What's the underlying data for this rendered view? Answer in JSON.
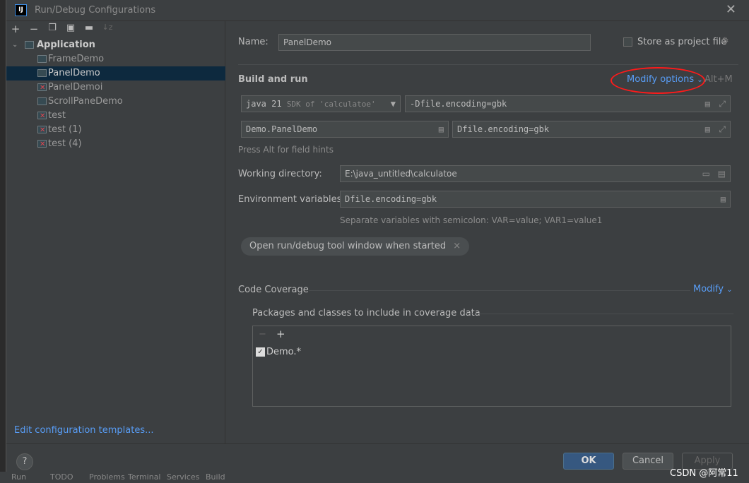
{
  "window": {
    "title": "Run/Debug Configurations",
    "logo": "IJ"
  },
  "toolbar": {
    "icons": [
      "plus-icon",
      "minus-icon",
      "copy-icon",
      "save-icon",
      "new-folder-icon",
      "sort-az-icon"
    ]
  },
  "tree": {
    "root": "Application",
    "items": [
      {
        "label": "FrameDemo",
        "error": false,
        "selected": false
      },
      {
        "label": "PanelDemo",
        "error": false,
        "selected": true
      },
      {
        "label": "PanelDemoi",
        "error": true,
        "selected": false
      },
      {
        "label": "ScrollPaneDemo",
        "error": false,
        "selected": false
      },
      {
        "label": "test",
        "error": true,
        "selected": false
      },
      {
        "label": "test (1)",
        "error": true,
        "selected": false
      },
      {
        "label": "test (4)",
        "error": true,
        "selected": false
      }
    ]
  },
  "edit_templates": "Edit configuration templates...",
  "form": {
    "name_label": "Name:",
    "name_value": "PanelDemo",
    "store_label": "Store as project file",
    "store_checked": false,
    "build_run": "Build and run",
    "modify_options": "Modify options",
    "modify_shortcut": "Alt+M",
    "jdk_value": "java 21",
    "jdk_hint": "SDK of 'calculatoe'",
    "vm_options": "-Dfile.encoding=gbk",
    "main_class": "Demo.PanelDemo",
    "program_args": "Dfile.encoding=gbk",
    "field_hint": "Press Alt for field hints",
    "workdir_label": "Working directory:",
    "workdir_value": "E:\\java_untitled\\calculatoe",
    "env_label": "Environment variables:",
    "env_value": "Dfile.encoding=gbk",
    "env_hint": "Separate variables with semicolon: VAR=value; VAR1=value1",
    "chip": "Open run/debug tool window when started",
    "coverage": "Code Coverage",
    "coverage_modify": "Modify",
    "packages_label": "Packages and classes to include in coverage data",
    "packages": [
      {
        "label": "Demo.*",
        "checked": true
      }
    ]
  },
  "buttons": {
    "ok": "OK",
    "cancel": "Cancel",
    "apply": "Apply",
    "help": "?"
  },
  "ide_tabs": [
    "Run",
    "TODO",
    "Problems",
    "Terminal",
    "Services",
    "Build"
  ],
  "watermark": "CSDN @阿常11",
  "colors": {
    "accent": "#589df6",
    "selection": "#0d293e",
    "ok": "#365880",
    "annotation": "#ff0000"
  }
}
